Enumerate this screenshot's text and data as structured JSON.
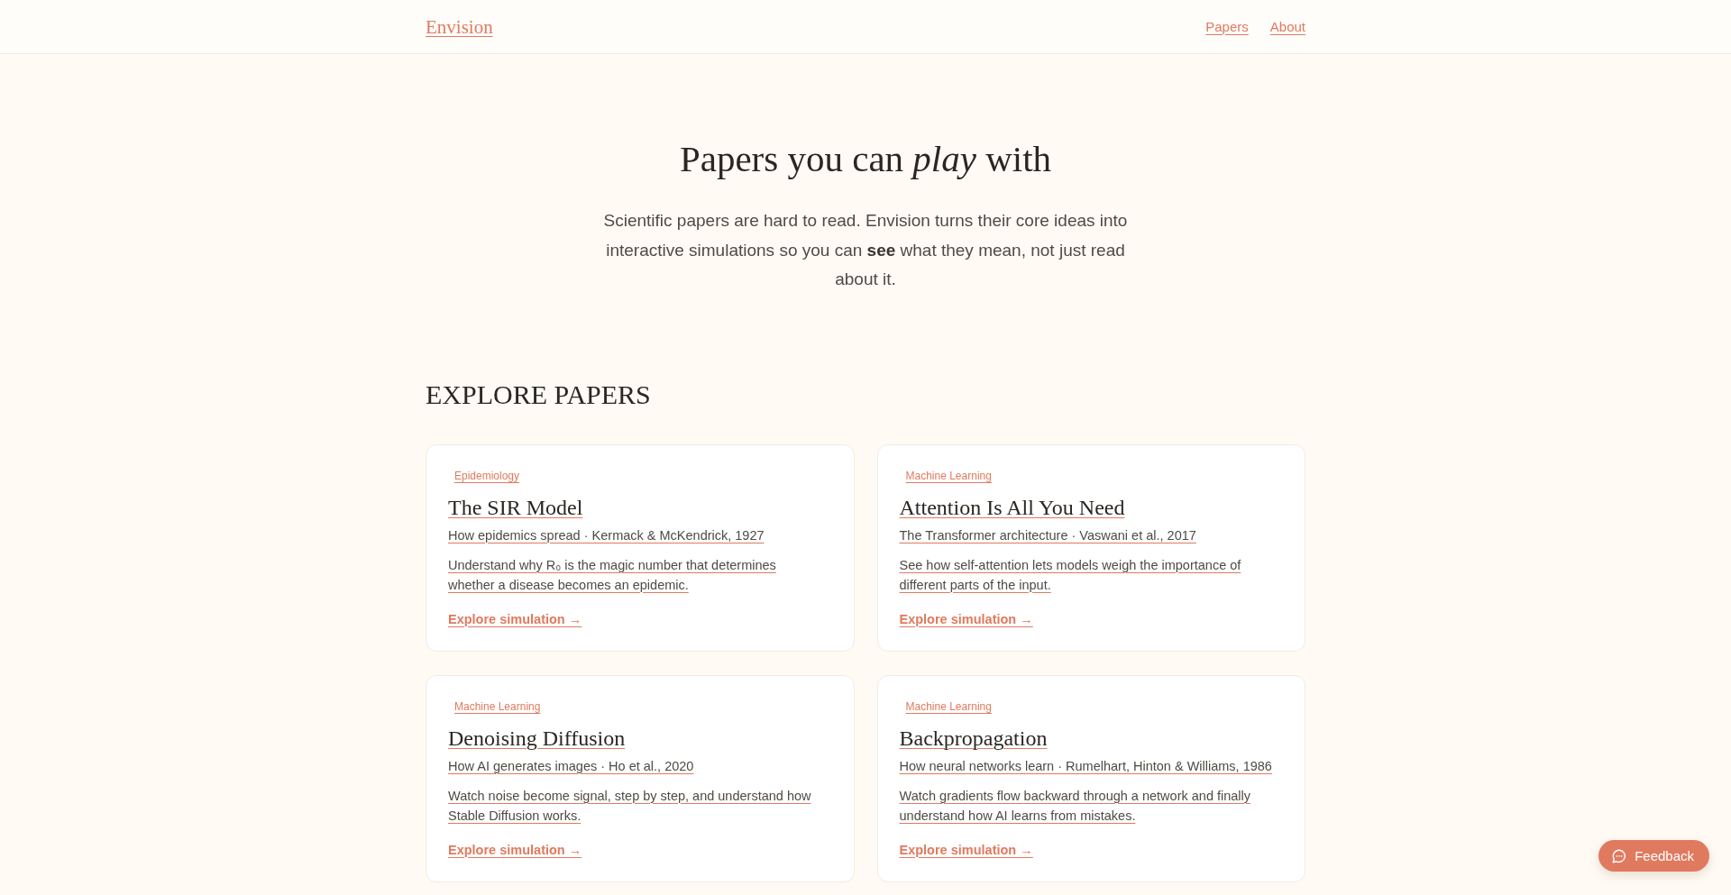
{
  "header": {
    "logo": "Envision",
    "nav": [
      {
        "label": "Papers"
      },
      {
        "label": "About"
      }
    ]
  },
  "hero": {
    "title": "Papers you can *play* with",
    "subtitle": "Scientific papers are hard to read. Envision turns their core ideas into interactive simulations so you can **see** what they mean, not just read about it."
  },
  "papers": {
    "heading": "EXPLORE PAPERS",
    "cards": [
      {
        "tag": "Epidemiology",
        "title": "The SIR Model",
        "subtitle": "How epidemics spread · Kermack & McKendrick, 1927",
        "description": "Understand why R₀ is the magic number that determines whether a disease becomes an epidemic.",
        "link": "Explore simulation →"
      },
      {
        "tag": "Machine Learning",
        "title": "Attention Is All You Need",
        "subtitle": "The Transformer architecture · Vaswani et al., 2017",
        "description": "See how self-attention lets models weigh the importance of different parts of the input.",
        "link": "Explore simulation →"
      },
      {
        "tag": "Machine Learning",
        "title": "Denoising Diffusion",
        "subtitle": "How AI generates images · Ho et al., 2020",
        "description": "Watch noise become signal, step by step, and understand how Stable Diffusion works.",
        "link": "Explore simulation →"
      },
      {
        "tag": "Machine Learning",
        "title": "Backpropagation",
        "subtitle": "How neural networks learn · Rumelhart, Hinton & Williams, 1986",
        "description": "Watch gradients flow backward through a network and finally understand how AI learns from mistakes.",
        "link": "Explore simulation →"
      }
    ]
  },
  "feedback_button": {
    "label": "Feedback"
  }
}
